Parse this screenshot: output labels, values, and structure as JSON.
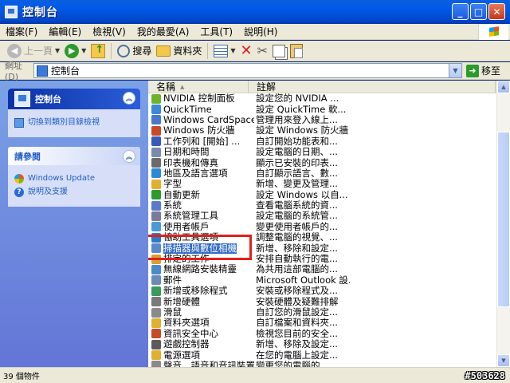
{
  "window": {
    "title": "控制台",
    "minimize": "_",
    "maximize": "□",
    "close": "✕"
  },
  "menu": [
    "檔案(F)",
    "編輯(E)",
    "檢視(V)",
    "我的最愛(A)",
    "工具(T)",
    "說明(H)"
  ],
  "toolbar": {
    "back_label": "上一頁",
    "search_label": "搜尋",
    "folders_label": "資料夾"
  },
  "address": {
    "label": "網址(D)",
    "value": "控制台",
    "go_label": "移至"
  },
  "left_pane": {
    "control_panel": {
      "title": "控制台",
      "switch_link": "切換到類別目錄檢視"
    },
    "see_also": {
      "title": "請參閱",
      "links": [
        "Windows Update",
        "說明及支援"
      ]
    }
  },
  "list": {
    "columns": [
      "名稱",
      "註解"
    ],
    "items": [
      {
        "name": "NVIDIA 控制面板",
        "note": "設定您的 NVIDIA ...",
        "color": "#6bb42c"
      },
      {
        "name": "QuickTime",
        "note": "設定 QuickTime 軟...",
        "color": "#3a8ad8"
      },
      {
        "name": "Windows CardSpace",
        "note": "管理用來登入線上...",
        "color": "#4a78c8"
      },
      {
        "name": "Windows 防火牆",
        "note": "設定 Windows 防火牆",
        "color": "#c84a2a"
      },
      {
        "name": "工作列和 [開始] ...",
        "note": "自訂開始功能表和...",
        "color": "#3a5ab8"
      },
      {
        "name": "日期和時間",
        "note": "設定電腦的日期、...",
        "color": "#7a8ab0"
      },
      {
        "name": "印表機和傳真",
        "note": "顯示已安裝的印表...",
        "color": "#6a6a6a"
      },
      {
        "name": "地區及語言選項",
        "note": "自訂顯示語言、數...",
        "color": "#2a8ad8"
      },
      {
        "name": "字型",
        "note": "新增、變更及管理...",
        "color": "#e0b030"
      },
      {
        "name": "自動更新",
        "note": "設定 Windows 以自...",
        "color": "#2c9a2c"
      },
      {
        "name": "系統",
        "note": "查看電腦系統的資...",
        "color": "#5a7ac8"
      },
      {
        "name": "系統管理工具",
        "note": "設定電腦的系統管...",
        "color": "#7a7a9a"
      },
      {
        "name": "使用者帳戶",
        "note": "變更使用者帳戶的...",
        "color": "#4a9ad8"
      },
      {
        "name": "協助工具選項",
        "note": "調整電腦的視覺、...",
        "color": "#2a7ac8"
      },
      {
        "name": "掃描器與數位相機",
        "note": "新增、移除和設定...",
        "color": "#5a8aca"
      },
      {
        "name": "排定的工作",
        "note": "安排自動執行的電...",
        "color": "#d8a030"
      },
      {
        "name": "無線網路安裝精靈",
        "note": "為共用這部電腦的...",
        "color": "#4a8ac8"
      },
      {
        "name": "郵件",
        "note": "Microsoft Outlook 設...",
        "color": "#6a8ab8"
      },
      {
        "name": "新增或移除程式",
        "note": "安裝或移除程式及...",
        "color": "#3a9a5a"
      },
      {
        "name": "新增硬體",
        "note": "安裝硬體及疑難排解",
        "color": "#7a7a7a"
      },
      {
        "name": "滑鼠",
        "note": "自訂您的滑鼠設定...",
        "color": "#8a8a8a"
      },
      {
        "name": "資料夾選項",
        "note": "自訂檔案和資料夾...",
        "color": "#e0b030"
      },
      {
        "name": "資訊安全中心",
        "note": "檢視您目前的安全...",
        "color": "#c84a2a"
      },
      {
        "name": "遊戲控制器",
        "note": "新增、移除及設定...",
        "color": "#5a5a5a"
      },
      {
        "name": "電源選項",
        "note": "在您的電腦上設定...",
        "color": "#e0b030"
      },
      {
        "name": "聲音、語音和音訊裝置",
        "note": "變更您的電腦的...",
        "color": "#8a8a8a"
      }
    ]
  },
  "status": {
    "count": "39 個物件",
    "watermark": "#503628"
  }
}
